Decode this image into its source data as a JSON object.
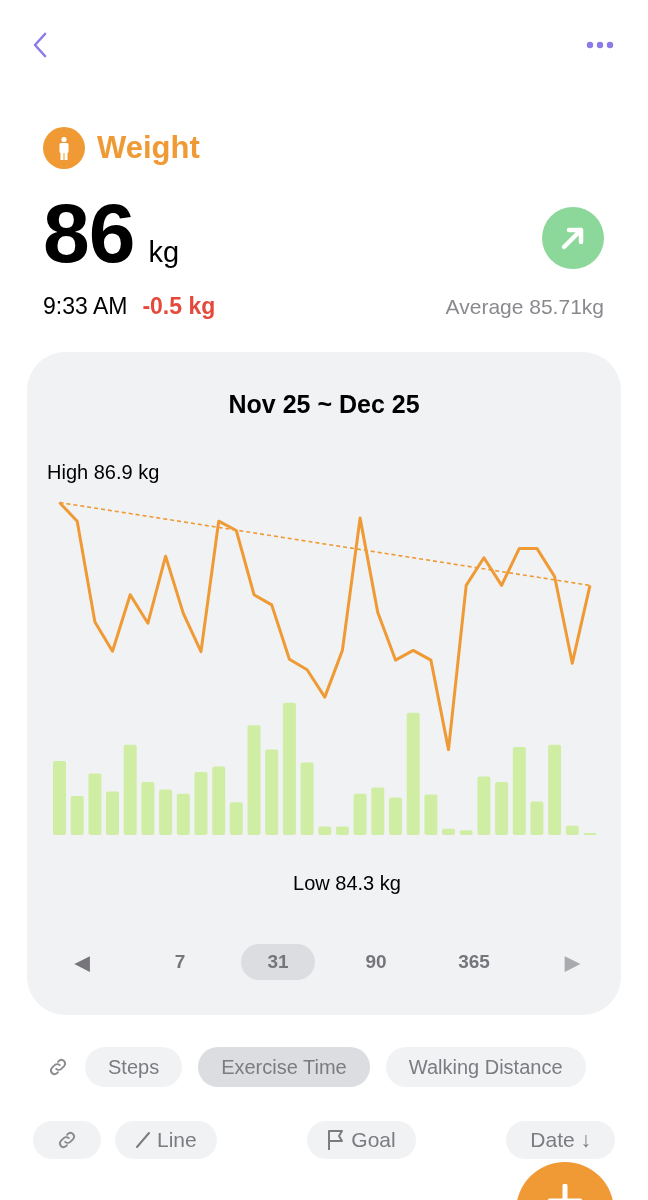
{
  "metric": {
    "title": "Weight",
    "value": "86",
    "unit": "kg",
    "rising": true,
    "time": "9:33 AM",
    "change": "-0.5 kg",
    "average": "Average 85.71kg"
  },
  "chart_card": {
    "range": "Nov 25 ~ Dec 25",
    "high_label": "High 86.9 kg",
    "low_label": "Low 84.3 kg",
    "prev": {
      "label": "◀",
      "disabled": false
    },
    "periods": [
      {
        "label": "7",
        "selected": false
      },
      {
        "label": "31",
        "selected": true
      },
      {
        "label": "90",
        "selected": false
      },
      {
        "label": "365",
        "selected": false
      }
    ],
    "next": {
      "label": "▶",
      "disabled": true
    }
  },
  "linked_metrics": [
    {
      "label": "Steps",
      "selected": false
    },
    {
      "label": "Exercise Time",
      "selected": true
    },
    {
      "label": "Walking Distance",
      "selected": false
    }
  ],
  "toolbar": [
    {
      "kind": "link"
    },
    {
      "kind": "line",
      "label": "Line"
    },
    {
      "kind": "goal",
      "label": "Goal"
    },
    {
      "kind": "sort",
      "label": "Date ↓"
    }
  ]
}
